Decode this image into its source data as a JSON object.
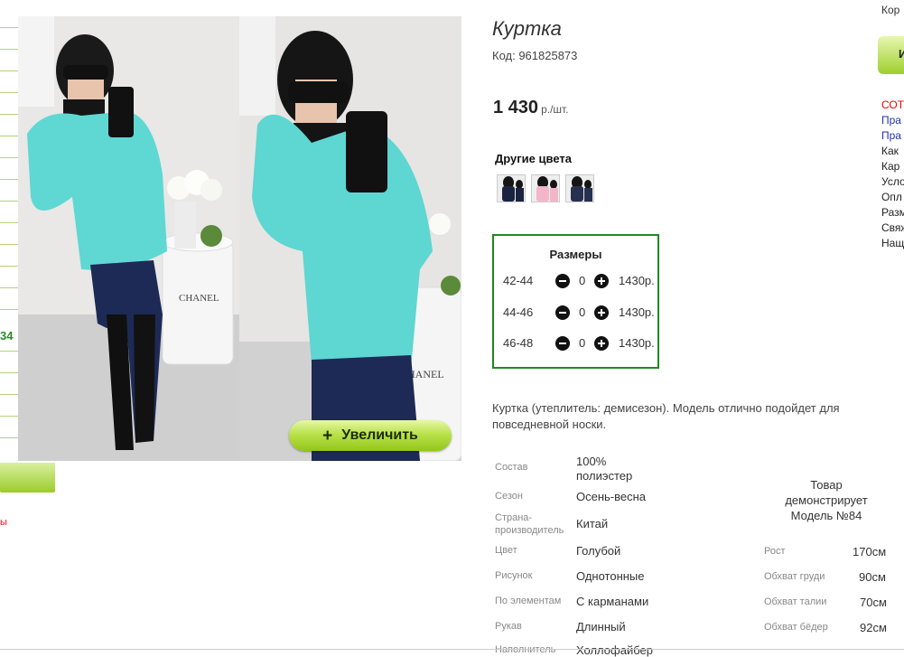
{
  "background_page": {
    "left_number": "34",
    "left_red_text": "ы",
    "top_right_text": "Кор",
    "green_button_text": "И",
    "links": [
      {
        "text": "СОТ",
        "color": "#ee0000"
      },
      {
        "text": "Пра",
        "color": "#2233aa"
      },
      {
        "text": "Пра",
        "color": "#2233aa"
      },
      {
        "text": "Как",
        "color": "#222222"
      },
      {
        "text": "Кар",
        "color": "#222222"
      },
      {
        "text": "Усло",
        "color": "#222222"
      },
      {
        "text": "Опл",
        "color": "#222222"
      },
      {
        "text": "Разм",
        "color": "#222222"
      },
      {
        "text": "Свяж",
        "color": "#222222"
      },
      {
        "text": "Нащ",
        "color": "#222222"
      }
    ]
  },
  "product": {
    "title": "Куртка",
    "code": "Код: 961825873",
    "price": "1 430",
    "price_unit": "р./шт.",
    "other_colors_label": "Другие цвета",
    "swatch_colors": [
      "#1a2440",
      "#f2b6c8",
      "#26304f"
    ],
    "zoom_button": {
      "icon": "plus-icon",
      "label": "Увеличить"
    },
    "sizes_title": "Размеры",
    "sizes": [
      {
        "label": "42-44",
        "qty": "0",
        "price": "1430р."
      },
      {
        "label": "44-46",
        "qty": "0",
        "price": "1430р."
      },
      {
        "label": "46-48",
        "qty": "0",
        "price": "1430р."
      }
    ],
    "description": "Куртка (утеплитель: демисезон). Модель отлично подойдет для повседневной носки.",
    "specs": [
      {
        "key": "Состав",
        "value": "100% полиэстер"
      },
      {
        "key": "Сезон",
        "value": "Осень-весна"
      },
      {
        "key": "Страна-производитель",
        "value": "Китай"
      },
      {
        "key": "Цвет",
        "value": "Голубой"
      },
      {
        "key": "Рисунок",
        "value": "Однотонные"
      },
      {
        "key": "По элементам",
        "value": "С карманами"
      },
      {
        "key": "Рукав",
        "value": "Длинный"
      },
      {
        "key": "Наполнитель",
        "value": "Холлофайбер"
      }
    ],
    "model_note": "Товар демонстрирует Модель №84",
    "model_params": [
      {
        "key": "Рост",
        "value": "170см"
      },
      {
        "key": "Обхват груди",
        "value": "90см"
      },
      {
        "key": "Обхват талии",
        "value": "70см"
      },
      {
        "key": "Обхват бёдер",
        "value": "92см"
      }
    ]
  },
  "colors": {
    "accent_green": "#9ccc2a",
    "border_green": "#1e8a1e",
    "jacket": "#5fd8d4"
  }
}
